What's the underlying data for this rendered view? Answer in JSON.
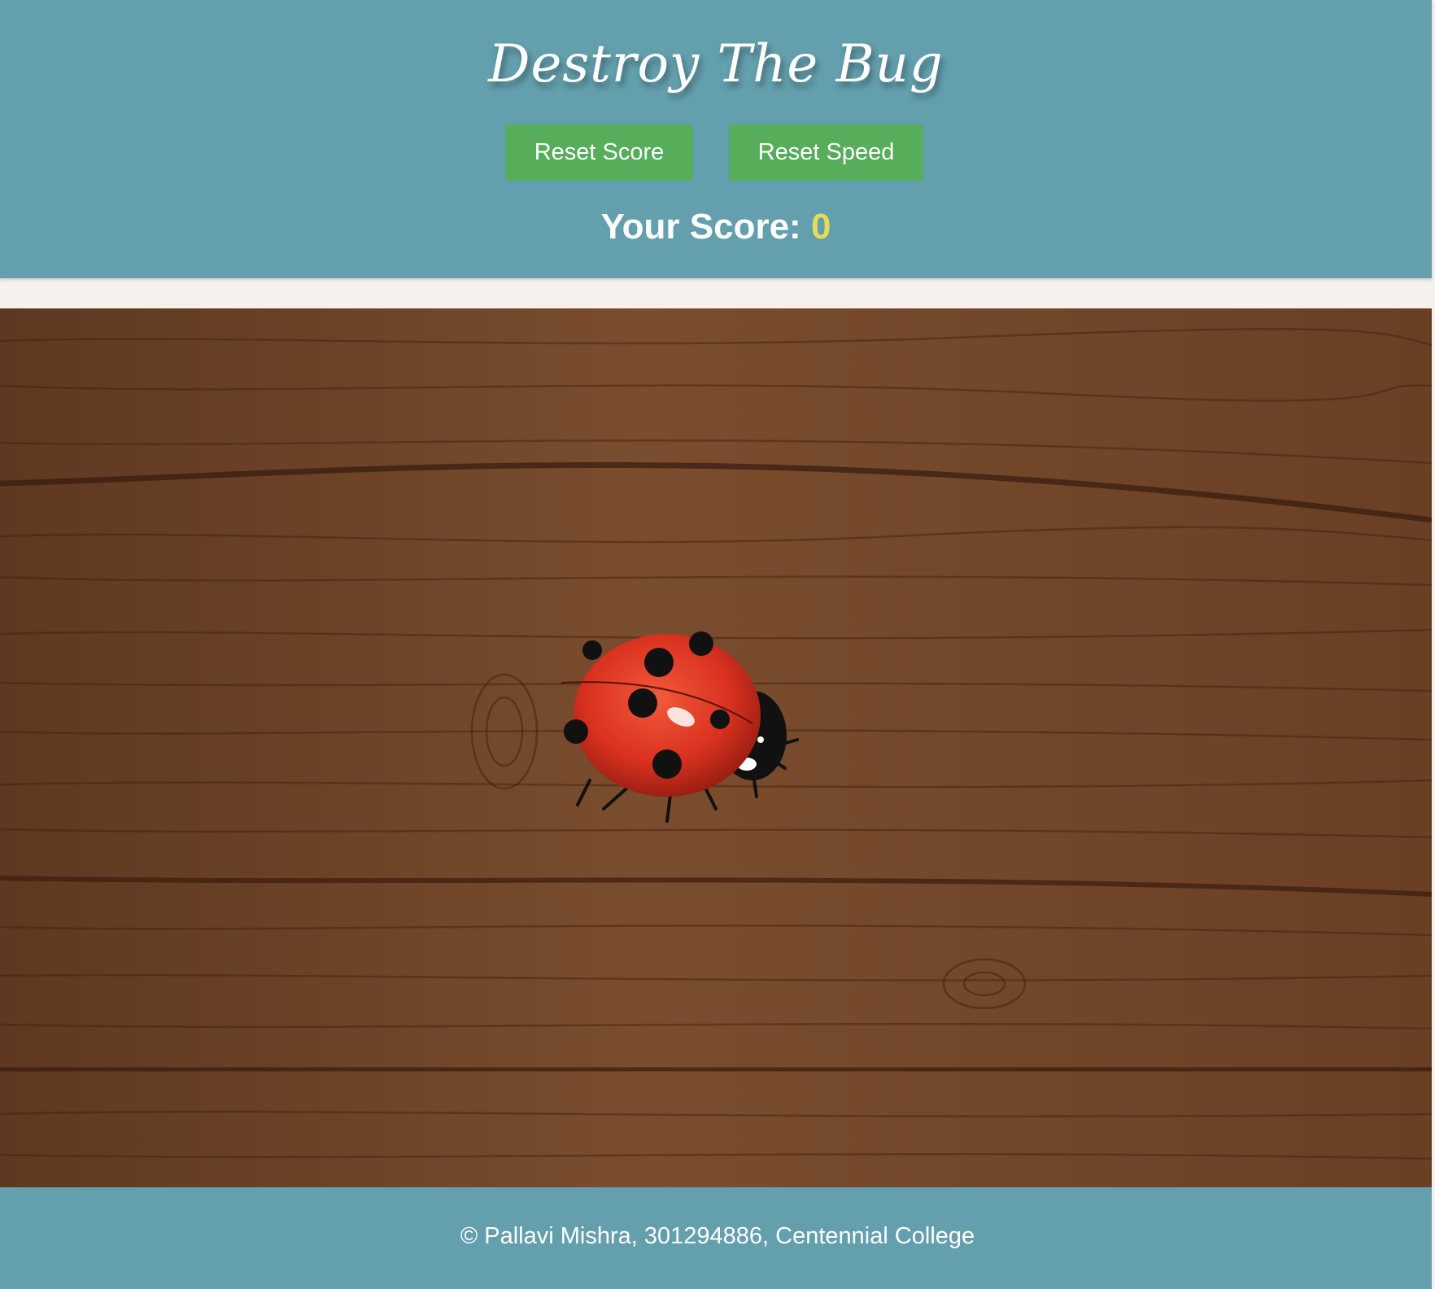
{
  "header": {
    "title": "Destroy The Bug",
    "reset_score_label": "Reset Score",
    "reset_speed_label": "Reset Speed",
    "score_label": "Your Score:",
    "score_value": "0"
  },
  "game": {
    "bug_icon": "ladybug-icon",
    "board_texture": "wood-plank"
  },
  "footer": {
    "text": "© Pallavi Mishra, 301294886, Centennial College"
  },
  "colors": {
    "header_bg": "#639fad",
    "button_bg": "#56ad5a",
    "score_value": "#e4dc56",
    "page_bg": "#f6f1ec"
  }
}
